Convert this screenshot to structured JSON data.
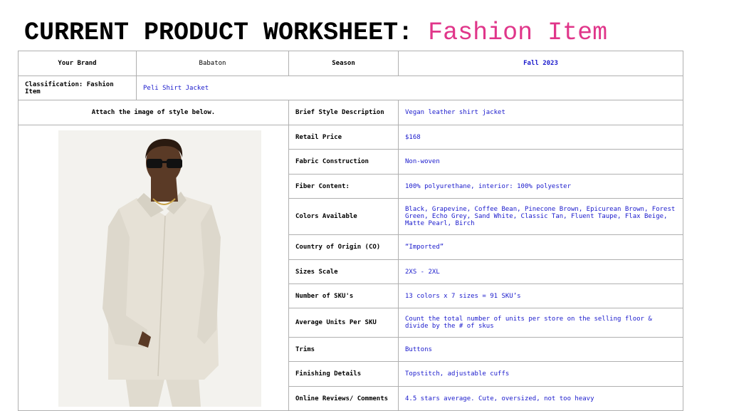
{
  "title": {
    "main": "CURRENT PRODUCT WORKSHEET: ",
    "accent": "Fashion Item"
  },
  "colors": {
    "accent": "#e0368a",
    "value_text": "#1a1acc",
    "border": "#b0b0b0"
  },
  "header_row": {
    "brand_label": "Your Brand",
    "brand_value": "Babaton",
    "season_label": "Season",
    "season_value": "Fall 2023"
  },
  "classification": {
    "label": "Classification: Fashion Item",
    "value": "Peli Shirt Jacket"
  },
  "image_prompt": "Attach the image of style below.",
  "details": [
    {
      "label": "Brief Style Description",
      "value": "Vegan leather shirt jacket"
    },
    {
      "label": "Retail Price",
      "value": "$168"
    },
    {
      "label": "Fabric Construction",
      "value": "Non-woven"
    },
    {
      "label": "Fiber Content:",
      "value": "100% polyurethane, interior: 100% polyester"
    },
    {
      "label": "Colors Available",
      "value": "Black, Grapevine, Coffee Bean, Pinecone Brown, Epicurean Brown, Forest Green, Echo Grey, Sand White, Classic Tan, Fluent Taupe, Flax Beige, Matte Pearl, Birch"
    },
    {
      "label": "Country of Origin (CO)",
      "value": "“Imported”"
    },
    {
      "label": "Sizes Scale",
      "value": "2XS - 2XL"
    },
    {
      "label": "Number of SKU's",
      "value": "13 colors x 7 sizes = 91 SKU’s"
    },
    {
      "label": "Average Units Per SKU",
      "value": "Count the total number of units per store on the selling floor & divide by the # of skus"
    },
    {
      "label": "Trims",
      "value": "Buttons"
    },
    {
      "label": "Finishing Details",
      "value": "Topstitch, adjustable cuffs"
    },
    {
      "label": "Online Reviews/ Comments",
      "value": "4.5 stars average. Cute, oversized, not too heavy"
    }
  ]
}
